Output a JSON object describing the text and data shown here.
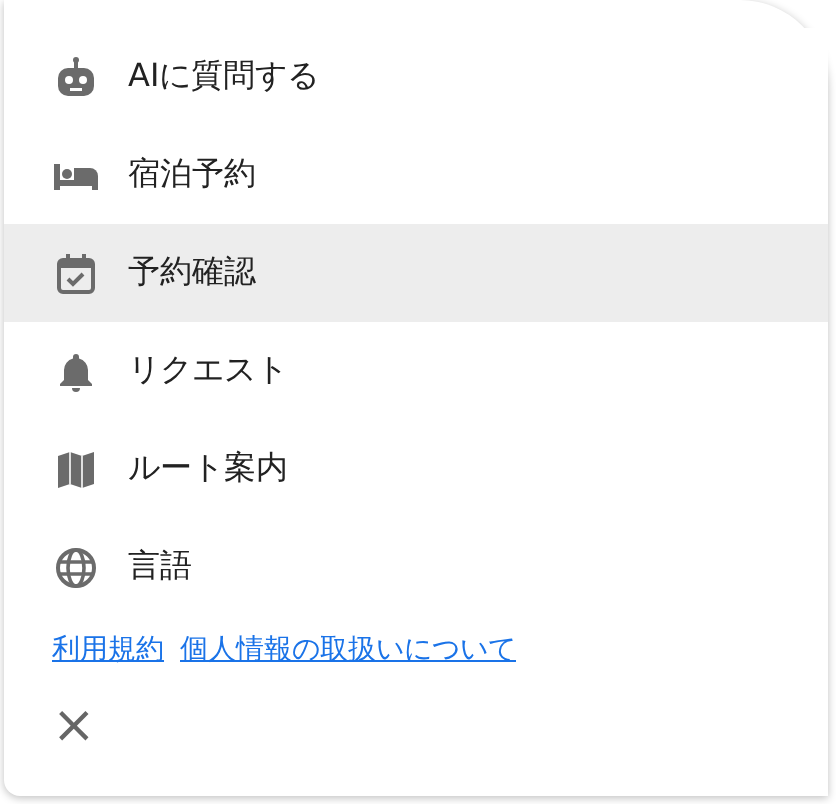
{
  "menu": {
    "items": [
      {
        "kind": "robot",
        "label": "AIに質問する",
        "selected": false
      },
      {
        "kind": "bed",
        "label": "宿泊予約",
        "selected": false
      },
      {
        "kind": "calendar",
        "label": "予約確認",
        "selected": true
      },
      {
        "kind": "bell",
        "label": "リクエスト",
        "selected": false
      },
      {
        "kind": "map",
        "label": "ルート案内",
        "selected": false
      },
      {
        "kind": "globe",
        "label": "言語",
        "selected": false
      }
    ],
    "links": [
      "利用規約",
      "個人情報の取扱いについて"
    ],
    "close": "×"
  }
}
